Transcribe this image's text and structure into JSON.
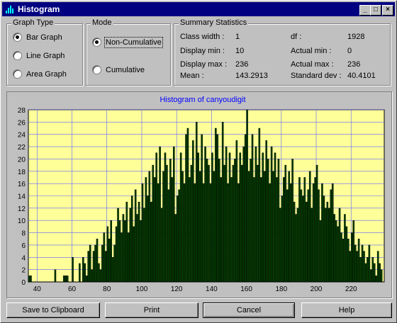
{
  "window": {
    "title": "Histogram",
    "title_bar_color": "#000080"
  },
  "graph_type": {
    "label": "Graph Type",
    "options": [
      {
        "label": "Bar Graph",
        "selected": true
      },
      {
        "label": "Line Graph",
        "selected": false
      },
      {
        "label": "Area Graph",
        "selected": false
      }
    ]
  },
  "mode": {
    "label": "Mode",
    "options": [
      {
        "label": "Non-Cumulative",
        "selected": true
      },
      {
        "label": "Cumulative",
        "selected": false
      }
    ]
  },
  "summary": {
    "label": "Summary Statistics",
    "class_width_label": "Class width :",
    "class_width": "1",
    "display_min_label": "Display min :",
    "display_min": "10",
    "display_max_label": "Display max :",
    "display_max": "236",
    "mean_label": "Mean :",
    "mean": "143.2913",
    "df_label": "df :",
    "df": "1928",
    "actual_min_label": "Actual min :",
    "actual_min": "0",
    "actual_max_label": "Actual max :",
    "actual_max": "236",
    "std_label": "Standard dev :",
    "std": "40.4101"
  },
  "buttons": {
    "clipboard": "Save to Clipboard",
    "print": "Print",
    "cancel": "Cancel",
    "help": "Help"
  },
  "chart_data": {
    "type": "bar",
    "title": "Histogram of canyoudigit",
    "xlim": [
      35,
      238
    ],
    "ylim": [
      0,
      28
    ],
    "x_ticks": [
      40,
      60,
      80,
      100,
      120,
      140,
      160,
      180,
      200,
      220
    ],
    "y_ticks": [
      0,
      2,
      4,
      6,
      8,
      10,
      12,
      14,
      16,
      18,
      20,
      22,
      24,
      26,
      28
    ],
    "grid": true,
    "colors": {
      "plot_bg": "#ffff99",
      "bar": "#004000",
      "grid": "#6060ff",
      "title": "#0000ff"
    },
    "x": [
      35,
      36,
      37,
      38,
      39,
      40,
      41,
      42,
      43,
      44,
      45,
      46,
      47,
      48,
      49,
      50,
      51,
      52,
      53,
      54,
      55,
      56,
      57,
      58,
      59,
      60,
      61,
      62,
      63,
      64,
      65,
      66,
      67,
      68,
      69,
      70,
      71,
      72,
      73,
      74,
      75,
      76,
      77,
      78,
      79,
      80,
      81,
      82,
      83,
      84,
      85,
      86,
      87,
      88,
      89,
      90,
      91,
      92,
      93,
      94,
      95,
      96,
      97,
      98,
      99,
      100,
      101,
      102,
      103,
      104,
      105,
      106,
      107,
      108,
      109,
      110,
      111,
      112,
      113,
      114,
      115,
      116,
      117,
      118,
      119,
      120,
      121,
      122,
      123,
      124,
      125,
      126,
      127,
      128,
      129,
      130,
      131,
      132,
      133,
      134,
      135,
      136,
      137,
      138,
      139,
      140,
      141,
      142,
      143,
      144,
      145,
      146,
      147,
      148,
      149,
      150,
      151,
      152,
      153,
      154,
      155,
      156,
      157,
      158,
      159,
      160,
      161,
      162,
      163,
      164,
      165,
      166,
      167,
      168,
      169,
      170,
      171,
      172,
      173,
      174,
      175,
      176,
      177,
      178,
      179,
      180,
      181,
      182,
      183,
      184,
      185,
      186,
      187,
      188,
      189,
      190,
      191,
      192,
      193,
      194,
      195,
      196,
      197,
      198,
      199,
      200,
      201,
      202,
      203,
      204,
      205,
      206,
      207,
      208,
      209,
      210,
      211,
      212,
      213,
      214,
      215,
      216,
      217,
      218,
      219,
      220,
      221,
      222,
      223,
      224,
      225,
      226,
      227,
      228,
      229,
      230,
      231,
      232,
      233,
      234,
      235,
      236,
      237
    ],
    "values": [
      1,
      1,
      0,
      0,
      0,
      0,
      0,
      0,
      0,
      0,
      0,
      0,
      0,
      0,
      0,
      2,
      0,
      0,
      0,
      0,
      1,
      1,
      1,
      0,
      0,
      4,
      0,
      0,
      0,
      3,
      0,
      4,
      3,
      1,
      5,
      6,
      2,
      5,
      6,
      7,
      3,
      2,
      6,
      8,
      5,
      9,
      7,
      10,
      4,
      6,
      9,
      12,
      10,
      8,
      11,
      10,
      13,
      8,
      12,
      14,
      9,
      15,
      11,
      13,
      10,
      16,
      12,
      17,
      14,
      18,
      13,
      19,
      17,
      21,
      16,
      22,
      12,
      18,
      21,
      19,
      15,
      20,
      17,
      22,
      11,
      14,
      15,
      21,
      18,
      16,
      24,
      25,
      17,
      19,
      23,
      16,
      26,
      21,
      18,
      24,
      16,
      22,
      20,
      19,
      16,
      21,
      18,
      25,
      24,
      20,
      17,
      26,
      19,
      22,
      16,
      21,
      17,
      19,
      20,
      23,
      16,
      21,
      19,
      22,
      24,
      28,
      18,
      20,
      24,
      17,
      22,
      19,
      25,
      17,
      21,
      18,
      23,
      20,
      16,
      22,
      18,
      21,
      17,
      20,
      12,
      14,
      17,
      19,
      15,
      18,
      16,
      20,
      13,
      11,
      12,
      17,
      15,
      14,
      17,
      13,
      15,
      18,
      12,
      16,
      17,
      19,
      15,
      10,
      16,
      14,
      12,
      13,
      12,
      15,
      16,
      11,
      10,
      9,
      12,
      8,
      7,
      11,
      9,
      7,
      5,
      8,
      10,
      6,
      5,
      7,
      4,
      6,
      5,
      3,
      4,
      6,
      2,
      4,
      3,
      1,
      5,
      3,
      2,
      4,
      3,
      2,
      1,
      1
    ]
  }
}
